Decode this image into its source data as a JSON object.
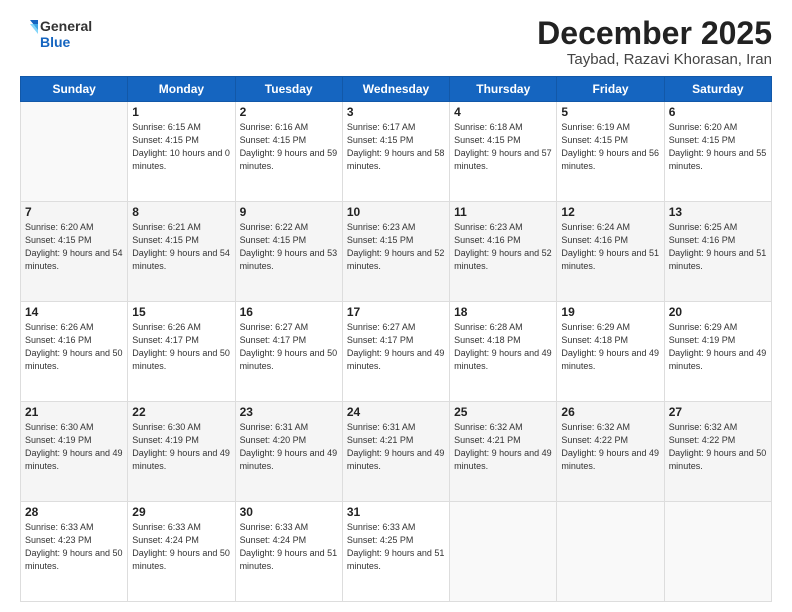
{
  "header": {
    "logo_line1": "General",
    "logo_line2": "Blue",
    "title": "December 2025",
    "subtitle": "Taybad, Razavi Khorasan, Iran"
  },
  "days_of_week": [
    "Sunday",
    "Monday",
    "Tuesday",
    "Wednesday",
    "Thursday",
    "Friday",
    "Saturday"
  ],
  "weeks": [
    [
      {
        "day": "",
        "sunrise": "",
        "sunset": "",
        "daylight": ""
      },
      {
        "day": "1",
        "sunrise": "Sunrise: 6:15 AM",
        "sunset": "Sunset: 4:15 PM",
        "daylight": "Daylight: 10 hours and 0 minutes."
      },
      {
        "day": "2",
        "sunrise": "Sunrise: 6:16 AM",
        "sunset": "Sunset: 4:15 PM",
        "daylight": "Daylight: 9 hours and 59 minutes."
      },
      {
        "day": "3",
        "sunrise": "Sunrise: 6:17 AM",
        "sunset": "Sunset: 4:15 PM",
        "daylight": "Daylight: 9 hours and 58 minutes."
      },
      {
        "day": "4",
        "sunrise": "Sunrise: 6:18 AM",
        "sunset": "Sunset: 4:15 PM",
        "daylight": "Daylight: 9 hours and 57 minutes."
      },
      {
        "day": "5",
        "sunrise": "Sunrise: 6:19 AM",
        "sunset": "Sunset: 4:15 PM",
        "daylight": "Daylight: 9 hours and 56 minutes."
      },
      {
        "day": "6",
        "sunrise": "Sunrise: 6:20 AM",
        "sunset": "Sunset: 4:15 PM",
        "daylight": "Daylight: 9 hours and 55 minutes."
      }
    ],
    [
      {
        "day": "7",
        "sunrise": "Sunrise: 6:20 AM",
        "sunset": "Sunset: 4:15 PM",
        "daylight": "Daylight: 9 hours and 54 minutes."
      },
      {
        "day": "8",
        "sunrise": "Sunrise: 6:21 AM",
        "sunset": "Sunset: 4:15 PM",
        "daylight": "Daylight: 9 hours and 54 minutes."
      },
      {
        "day": "9",
        "sunrise": "Sunrise: 6:22 AM",
        "sunset": "Sunset: 4:15 PM",
        "daylight": "Daylight: 9 hours and 53 minutes."
      },
      {
        "day": "10",
        "sunrise": "Sunrise: 6:23 AM",
        "sunset": "Sunset: 4:15 PM",
        "daylight": "Daylight: 9 hours and 52 minutes."
      },
      {
        "day": "11",
        "sunrise": "Sunrise: 6:23 AM",
        "sunset": "Sunset: 4:16 PM",
        "daylight": "Daylight: 9 hours and 52 minutes."
      },
      {
        "day": "12",
        "sunrise": "Sunrise: 6:24 AM",
        "sunset": "Sunset: 4:16 PM",
        "daylight": "Daylight: 9 hours and 51 minutes."
      },
      {
        "day": "13",
        "sunrise": "Sunrise: 6:25 AM",
        "sunset": "Sunset: 4:16 PM",
        "daylight": "Daylight: 9 hours and 51 minutes."
      }
    ],
    [
      {
        "day": "14",
        "sunrise": "Sunrise: 6:26 AM",
        "sunset": "Sunset: 4:16 PM",
        "daylight": "Daylight: 9 hours and 50 minutes."
      },
      {
        "day": "15",
        "sunrise": "Sunrise: 6:26 AM",
        "sunset": "Sunset: 4:17 PM",
        "daylight": "Daylight: 9 hours and 50 minutes."
      },
      {
        "day": "16",
        "sunrise": "Sunrise: 6:27 AM",
        "sunset": "Sunset: 4:17 PM",
        "daylight": "Daylight: 9 hours and 50 minutes."
      },
      {
        "day": "17",
        "sunrise": "Sunrise: 6:27 AM",
        "sunset": "Sunset: 4:17 PM",
        "daylight": "Daylight: 9 hours and 49 minutes."
      },
      {
        "day": "18",
        "sunrise": "Sunrise: 6:28 AM",
        "sunset": "Sunset: 4:18 PM",
        "daylight": "Daylight: 9 hours and 49 minutes."
      },
      {
        "day": "19",
        "sunrise": "Sunrise: 6:29 AM",
        "sunset": "Sunset: 4:18 PM",
        "daylight": "Daylight: 9 hours and 49 minutes."
      },
      {
        "day": "20",
        "sunrise": "Sunrise: 6:29 AM",
        "sunset": "Sunset: 4:19 PM",
        "daylight": "Daylight: 9 hours and 49 minutes."
      }
    ],
    [
      {
        "day": "21",
        "sunrise": "Sunrise: 6:30 AM",
        "sunset": "Sunset: 4:19 PM",
        "daylight": "Daylight: 9 hours and 49 minutes."
      },
      {
        "day": "22",
        "sunrise": "Sunrise: 6:30 AM",
        "sunset": "Sunset: 4:19 PM",
        "daylight": "Daylight: 9 hours and 49 minutes."
      },
      {
        "day": "23",
        "sunrise": "Sunrise: 6:31 AM",
        "sunset": "Sunset: 4:20 PM",
        "daylight": "Daylight: 9 hours and 49 minutes."
      },
      {
        "day": "24",
        "sunrise": "Sunrise: 6:31 AM",
        "sunset": "Sunset: 4:21 PM",
        "daylight": "Daylight: 9 hours and 49 minutes."
      },
      {
        "day": "25",
        "sunrise": "Sunrise: 6:32 AM",
        "sunset": "Sunset: 4:21 PM",
        "daylight": "Daylight: 9 hours and 49 minutes."
      },
      {
        "day": "26",
        "sunrise": "Sunrise: 6:32 AM",
        "sunset": "Sunset: 4:22 PM",
        "daylight": "Daylight: 9 hours and 49 minutes."
      },
      {
        "day": "27",
        "sunrise": "Sunrise: 6:32 AM",
        "sunset": "Sunset: 4:22 PM",
        "daylight": "Daylight: 9 hours and 50 minutes."
      }
    ],
    [
      {
        "day": "28",
        "sunrise": "Sunrise: 6:33 AM",
        "sunset": "Sunset: 4:23 PM",
        "daylight": "Daylight: 9 hours and 50 minutes."
      },
      {
        "day": "29",
        "sunrise": "Sunrise: 6:33 AM",
        "sunset": "Sunset: 4:24 PM",
        "daylight": "Daylight: 9 hours and 50 minutes."
      },
      {
        "day": "30",
        "sunrise": "Sunrise: 6:33 AM",
        "sunset": "Sunset: 4:24 PM",
        "daylight": "Daylight: 9 hours and 51 minutes."
      },
      {
        "day": "31",
        "sunrise": "Sunrise: 6:33 AM",
        "sunset": "Sunset: 4:25 PM",
        "daylight": "Daylight: 9 hours and 51 minutes."
      },
      {
        "day": "",
        "sunrise": "",
        "sunset": "",
        "daylight": ""
      },
      {
        "day": "",
        "sunrise": "",
        "sunset": "",
        "daylight": ""
      },
      {
        "day": "",
        "sunrise": "",
        "sunset": "",
        "daylight": ""
      }
    ]
  ]
}
